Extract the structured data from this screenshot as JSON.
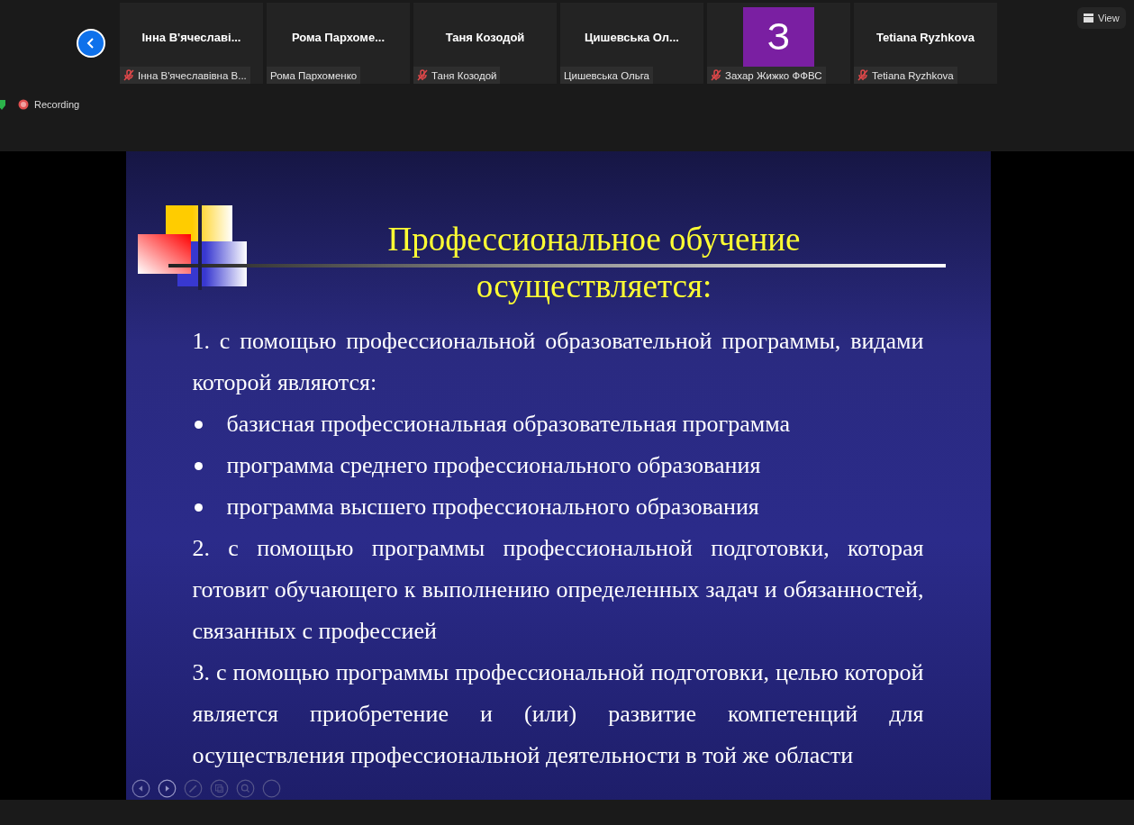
{
  "participants": [
    {
      "kind": "name",
      "display": "Інна  В'ячеславі...",
      "label": "Інна В'ячеславівна В...",
      "muted": true
    },
    {
      "kind": "name",
      "display": "Рома  Пархоме...",
      "label": "Рома Пархоменко",
      "muted": false
    },
    {
      "kind": "name",
      "display": "Таня Козодой",
      "label": "Таня Козодой",
      "muted": true
    },
    {
      "kind": "name",
      "display": "Цишевська  Ол...",
      "label": "Цишевська Ольга",
      "muted": false
    },
    {
      "kind": "avatar",
      "display": "З",
      "label": "Захар Жижко ФФВС",
      "muted": true
    },
    {
      "kind": "name",
      "display": "Tetiana Ryzhkova",
      "label": "Tetiana Ryzhkova",
      "muted": true
    }
  ],
  "view_button": "View",
  "recording": "Recording",
  "slide": {
    "title": [
      "Профессиональное обучение",
      "осуществляется:"
    ],
    "paragraphs": [
      {
        "kind": "numbered",
        "text": "1. с помощью профессиональной образовательной программы, видами которой являются:"
      },
      {
        "kind": "bullet",
        "text": "базисная профессиональная образовательная программа"
      },
      {
        "kind": "bullet",
        "text": "программа среднего профессионального образования"
      },
      {
        "kind": "bullet",
        "text": "программа высшего профессионального образования"
      },
      {
        "kind": "numbered",
        "text": "2. с помощью программы профессиональной подготовки, которая готовит обучающего к выполнению определенных задач и обязанностей, связанных с профессией"
      },
      {
        "kind": "numbered",
        "text": "3. с помощью программы профессиональной подготовки, целью которой является приобретение и (или) развитие компетенций для осуществления профессиональной деятельности в той же области"
      }
    ]
  }
}
